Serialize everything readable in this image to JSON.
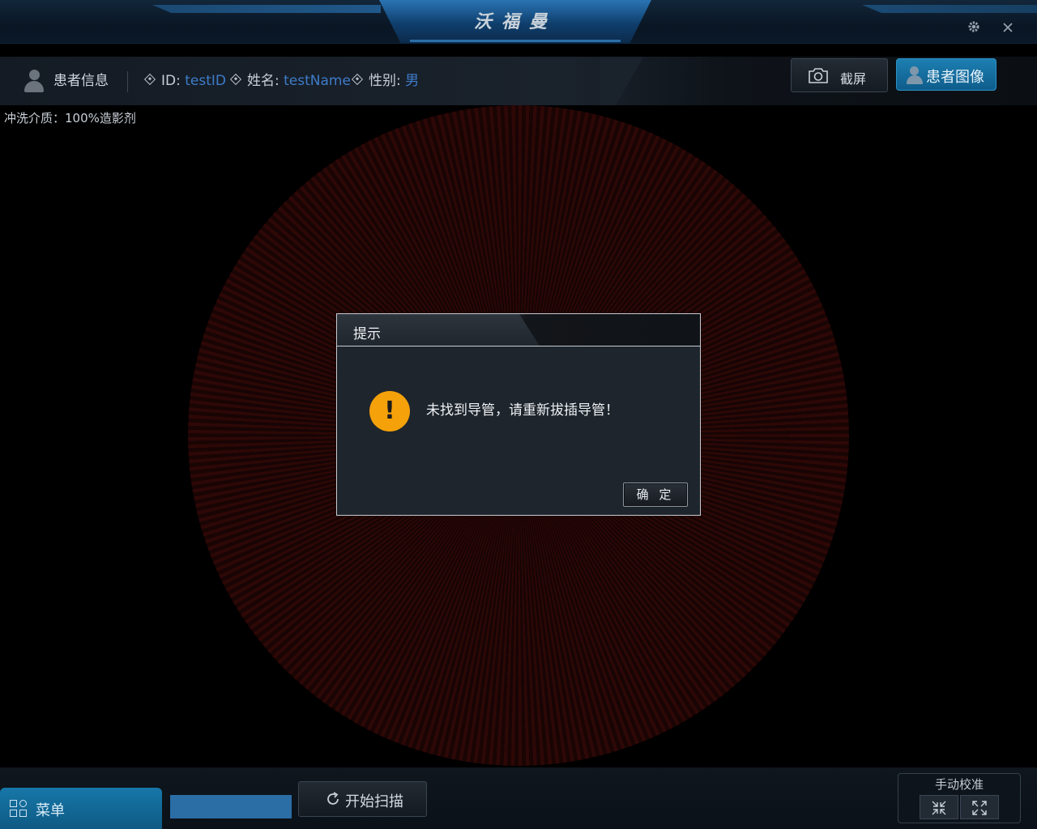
{
  "app": {
    "title": "沃福曼"
  },
  "window": {
    "settings_icon": "gear-icon",
    "close_icon": "close-icon"
  },
  "patient": {
    "section_label": "患者信息",
    "id_label": "ID:",
    "id_value": "testID",
    "name_label": "姓名:",
    "name_value": "testName",
    "sex_label": "性别:",
    "sex_value": "男"
  },
  "toolbar": {
    "screenshot_label": "截屏",
    "patient_image_label": "患者图像"
  },
  "image_view": {
    "flush_medium": "冲洗介质：100%造影剂"
  },
  "dialog": {
    "title": "提示",
    "message": "未找到导管，请重新拔插导管！",
    "icon": "warning-icon",
    "ok_label": "确 定"
  },
  "bottom": {
    "menu_label": "菜单",
    "progress": 1.0,
    "scan_label": "开始扫描",
    "calibration_label": "手动校准",
    "calib_shrink_icon": "collapse-icon",
    "calib_expand_icon": "expand-icon"
  },
  "colors": {
    "accent": "#1677a8",
    "value_text": "#3e7cc9",
    "warning": "#f5a10a"
  }
}
